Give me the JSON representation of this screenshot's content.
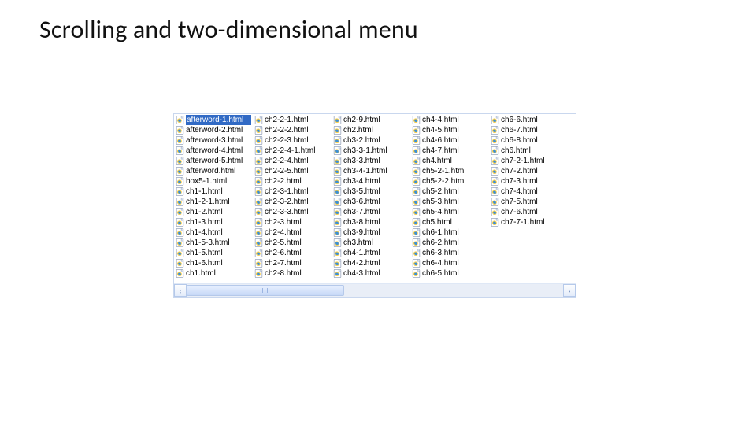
{
  "title": "Scrolling and two-dimensional menu",
  "explorer": {
    "selected_index": 0,
    "columns": [
      [
        "afterword-1.html",
        "afterword-2.html",
        "afterword-3.html",
        "afterword-4.html",
        "afterword-5.html",
        "afterword.html",
        "box5-1.html",
        "ch1-1.html",
        "ch1-2-1.html",
        "ch1-2.html",
        "ch1-3.html",
        "ch1-4.html",
        "ch1-5-3.html",
        "ch1-5.html",
        "ch1-6.html",
        "ch1.html"
      ],
      [
        "ch2-2-1.html",
        "ch2-2-2.html",
        "ch2-2-3.html",
        "ch2-2-4-1.html",
        "ch2-2-4.html",
        "ch2-2-5.html",
        "ch2-2.html",
        "ch2-3-1.html",
        "ch2-3-2.html",
        "ch2-3-3.html",
        "ch2-3.html",
        "ch2-4.html",
        "ch2-5.html",
        "ch2-6.html",
        "ch2-7.html",
        "ch2-8.html"
      ],
      [
        "ch2-9.html",
        "ch2.html",
        "ch3-2.html",
        "ch3-3-1.html",
        "ch3-3.html",
        "ch3-4-1.html",
        "ch3-4.html",
        "ch3-5.html",
        "ch3-6.html",
        "ch3-7.html",
        "ch3-8.html",
        "ch3-9.html",
        "ch3.html",
        "ch4-1.html",
        "ch4-2.html",
        "ch4-3.html"
      ],
      [
        "ch4-4.html",
        "ch4-5.html",
        "ch4-6.html",
        "ch4-7.html",
        "ch4.html",
        "ch5-2-1.html",
        "ch5-2-2.html",
        "ch5-2.html",
        "ch5-3.html",
        "ch5-4.html",
        "ch5.html",
        "ch6-1.html",
        "ch6-2.html",
        "ch6-3.html",
        "ch6-4.html",
        "ch6-5.html"
      ],
      [
        "ch6-6.html",
        "ch6-7.html",
        "ch6-8.html",
        "ch6.html",
        "ch7-2-1.html",
        "ch7-2.html",
        "ch7-3.html",
        "ch7-4.html",
        "ch7-5.html",
        "ch7-6.html",
        "ch7-7-1.html",
        "",
        "",
        "",
        "",
        ""
      ]
    ]
  },
  "scrollbar": {
    "left_glyph": "‹",
    "right_glyph": "›"
  }
}
